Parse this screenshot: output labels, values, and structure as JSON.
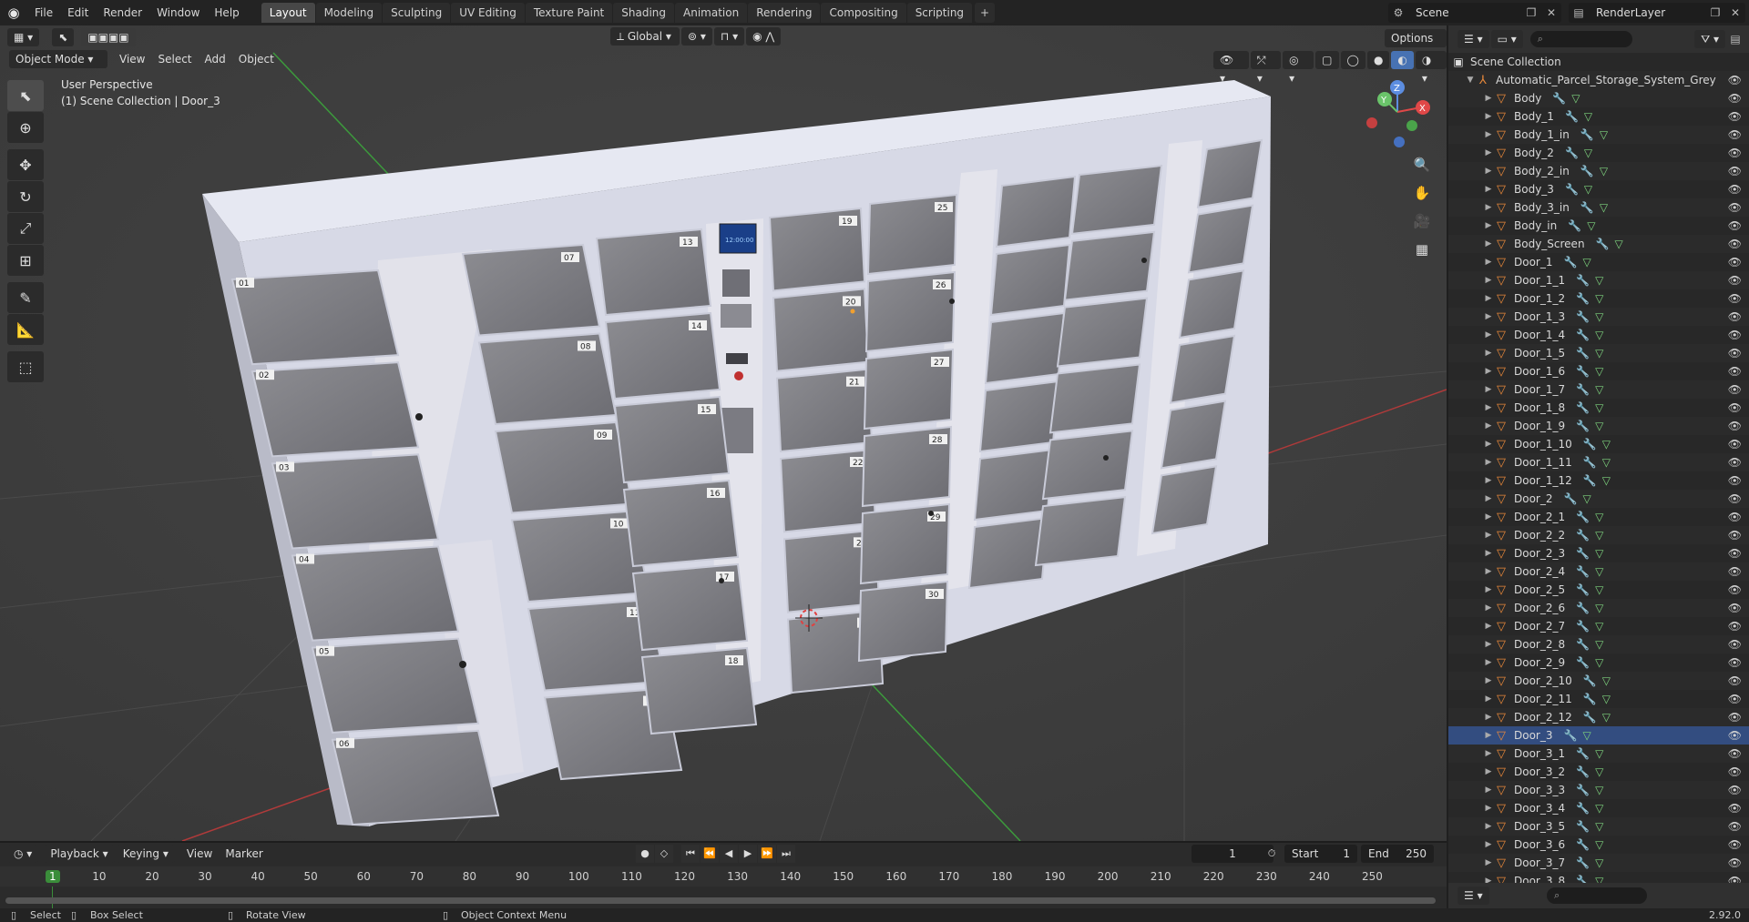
{
  "topbar": {
    "menus": [
      "File",
      "Edit",
      "Render",
      "Window",
      "Help"
    ],
    "workspaces": [
      "Layout",
      "Modeling",
      "Sculpting",
      "UV Editing",
      "Texture Paint",
      "Shading",
      "Animation",
      "Rendering",
      "Compositing",
      "Scripting"
    ],
    "active_workspace": "Layout",
    "add_tab": "+",
    "scene": "Scene",
    "view_layer": "RenderLayer"
  },
  "viewport": {
    "mode": "Object Mode",
    "menus": [
      "View",
      "Select",
      "Add",
      "Object"
    ],
    "orientation": "Global",
    "options": "Options",
    "perspective": "User Perspective",
    "collection_info": "(1) Scene Collection | Door_3",
    "axes": {
      "x": "X",
      "y": "Y",
      "z": "Z"
    }
  },
  "model": {
    "locker_labels": [
      "01",
      "02",
      "03",
      "04",
      "05",
      "06",
      "07",
      "08",
      "09",
      "10",
      "11",
      "12",
      "13",
      "14",
      "15",
      "16",
      "17",
      "18",
      "19",
      "20",
      "21",
      "22",
      "23",
      "24",
      "25",
      "26",
      "27",
      "28",
      "29",
      "30"
    ],
    "screen_text": "12:00:00"
  },
  "outliner": {
    "root": "Scene Collection",
    "collection": "Automatic_Parcel_Storage_System_Grey",
    "items": [
      "Body",
      "Body_1",
      "Body_1_in",
      "Body_2",
      "Body_2_in",
      "Body_3",
      "Body_3_in",
      "Body_in",
      "Body_Screen",
      "Door_1",
      "Door_1_1",
      "Door_1_2",
      "Door_1_3",
      "Door_1_4",
      "Door_1_5",
      "Door_1_6",
      "Door_1_7",
      "Door_1_8",
      "Door_1_9",
      "Door_1_10",
      "Door_1_11",
      "Door_1_12",
      "Door_2",
      "Door_2_1",
      "Door_2_2",
      "Door_2_3",
      "Door_2_4",
      "Door_2_5",
      "Door_2_6",
      "Door_2_7",
      "Door_2_8",
      "Door_2_9",
      "Door_2_10",
      "Door_2_11",
      "Door_2_12",
      "Door_3",
      "Door_3_1",
      "Door_3_2",
      "Door_3_3",
      "Door_3_4",
      "Door_3_5",
      "Door_3_6",
      "Door_3_7",
      "Door_3_8"
    ],
    "selected": "Door_3"
  },
  "timeline": {
    "menus": [
      "Playback",
      "Keying",
      "View",
      "Marker"
    ],
    "current_frame": "1",
    "start_label": "Start",
    "start": "1",
    "end_label": "End",
    "end": "250",
    "ticks": [
      "1",
      "10",
      "20",
      "30",
      "40",
      "50",
      "60",
      "70",
      "80",
      "90",
      "100",
      "110",
      "120",
      "130",
      "140",
      "150",
      "160",
      "170",
      "180",
      "190",
      "200",
      "210",
      "220",
      "230",
      "240",
      "250"
    ]
  },
  "statusbar": {
    "select": "Select",
    "box_select": "Box Select",
    "rotate": "Rotate View",
    "context": "Object Context Menu",
    "version": "2.92.0"
  },
  "colors": {
    "accent": "#4772b3",
    "object_icon": "#e8883a",
    "modifier_icon": "#6b9ad8",
    "mesh_icon": "#7ed37e",
    "frame_current": "#3a8d3a"
  }
}
